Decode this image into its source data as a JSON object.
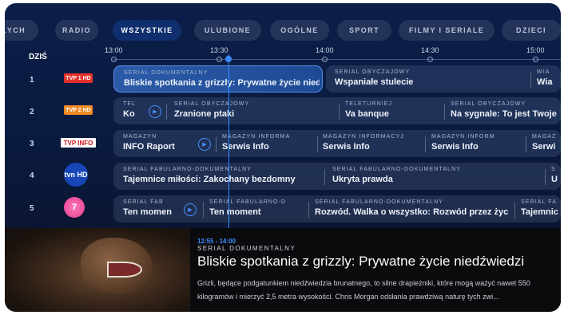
{
  "tabs": [
    "ŁYCH",
    "RADIO",
    "WSZYSTKIE",
    "ULUBIONE",
    "OGÓLNE",
    "SPORT",
    "FILMY I SERIALE",
    "DZIECI"
  ],
  "active_tab": "WSZYSTKIE",
  "timeline": {
    "today_label": "DZIŚ",
    "times": [
      "13:00",
      "13:30",
      "14:00",
      "14:30",
      "15:00"
    ]
  },
  "channels": [
    {
      "num": "1",
      "logo": "TVP 1 HD"
    },
    {
      "num": "2",
      "logo": "TVP 2 HD"
    },
    {
      "num": "3",
      "logo": "TVP INFO"
    },
    {
      "num": "4",
      "logo": "tvn HD"
    },
    {
      "num": "5",
      "logo": "7"
    }
  ],
  "rows": {
    "r1": {
      "a": {
        "cat": "SERIAL DOKUMENTALNY",
        "title": "Bliskie spotkania z grizzly: Prywatne życie niedźwiedzi"
      },
      "b": {
        "cat": "SERIAL OBYCZAJOWY",
        "title": "Wspaniałe stulecie"
      },
      "c": {
        "cat": "WIA",
        "title": "Wia"
      }
    },
    "r2": {
      "a": {
        "cat": "TEL",
        "title": "Ko"
      },
      "b": {
        "cat": "SERIAL OBYCZAJOWY",
        "title": "Zranione ptaki"
      },
      "c": {
        "cat": "TELETURNIEJ",
        "title": "Va banque"
      },
      "d": {
        "cat": "SERIAL OBYCZAJOWY",
        "title": "Na sygnale: To jest Twoje"
      }
    },
    "r3": {
      "a": {
        "cat": "MAGAZYN",
        "title": "INFO Raport"
      },
      "b": {
        "cat": "MAGAZYN INFORMA",
        "title": "Serwis Info"
      },
      "c": {
        "cat": "MAGAZYN INFORMACYJ",
        "title": "Serwis Info"
      },
      "d": {
        "cat": "MAGAZYN INFORM",
        "title": "Serwis Info"
      },
      "e": {
        "cat": "MAGAZ",
        "title": "Serwi"
      }
    },
    "r4": {
      "a": {
        "cat": "SERIAL FABULARNO-DOKUMENTALNY",
        "title": "Tajemnice miłości: Zakochany bezdomny"
      },
      "b": {
        "cat": "SERIAL FABULARNO-DOKUMENTALNY",
        "title": "Ukryta prawda"
      },
      "c": {
        "cat": "S",
        "title": "U"
      }
    },
    "r5": {
      "a": {
        "cat": "SERIAL FAB",
        "title": "Ten momen"
      },
      "b": {
        "cat": "SERIAL FABULARNO-D",
        "title": "Ten moment"
      },
      "c": {
        "cat": "SERIAL FABULARNO-DOKUMENTALNY",
        "title": "Rozwód. Walka o wszystko: Rozwód przez życ"
      },
      "d": {
        "cat": "SERIAL FA",
        "title": "Tajemnic"
      }
    }
  },
  "detail": {
    "time": "12:55 - 14:00",
    "category": "SERIAL DOKUMENTALNY",
    "title": "Bliskie spotkania z grizzly: Prywatne życie niedźwiedzi",
    "description": "Grizli, będące podgatunkiem niedźwiedzia brunatnego, to silne drapieżniki, które mogą ważyć nawet 550 kilogramów i mierzyć 2,5 metra wysokości. Chris Morgan odsłania prawdziwą naturę tych zwi..."
  },
  "colors": {
    "accent": "#3b8dff",
    "active_tab": "#0f2f6e",
    "tvp_red": "#e8312b",
    "tvp_orange": "#f08a24"
  }
}
